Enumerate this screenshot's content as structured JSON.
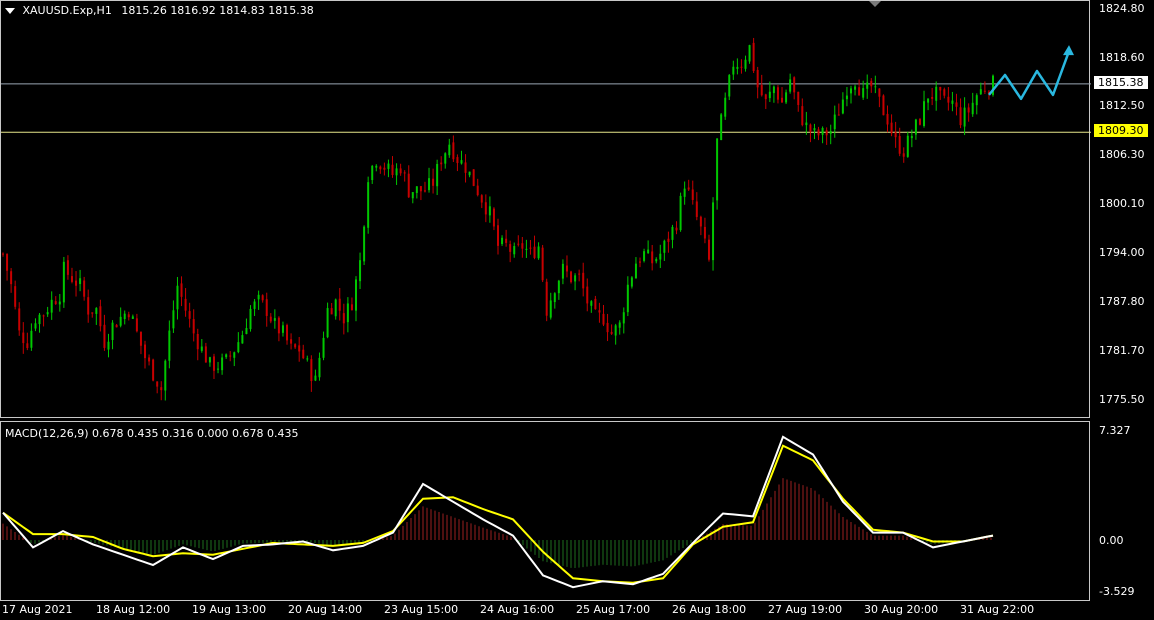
{
  "header": {
    "symbol": "XAUUSD.Exp,H1",
    "ohlc": "1815.26 1816.92 1814.83 1815.38"
  },
  "price_axis": {
    "ticks": [
      "1824.80",
      "1818.60",
      "1812.50",
      "1806.30",
      "1800.10",
      "1794.00",
      "1787.80",
      "1781.70",
      "1775.50"
    ]
  },
  "hlines": {
    "current": "1815.38",
    "level": "1809.30"
  },
  "macd": {
    "label": "MACD(12,26,9) 0.678 0.435 0.316 0.000 0.678 0.435",
    "ticks": [
      "7.327",
      "0.00",
      "-3.529"
    ]
  },
  "time_axis": {
    "ticks": [
      "17 Aug 2021",
      "18 Aug 12:00",
      "19 Aug 13:00",
      "20 Aug 14:00",
      "23 Aug 15:00",
      "24 Aug 16:00",
      "25 Aug 17:00",
      "26 Aug 18:00",
      "27 Aug 19:00",
      "30 Aug 20:00",
      "31 Aug 22:00"
    ]
  },
  "colors": {
    "bull": "#00c800",
    "bear": "#c80000",
    "macd_line": "#ffffff",
    "signal_line": "#ffff00",
    "hist_up": "#9a2020",
    "hist_down": "#1e6e1e",
    "forecast_arrow": "#2ab8e0"
  },
  "chart_data": {
    "type": "candlestick",
    "symbol": "XAUUSD",
    "timeframe": "H1",
    "y_range": [
      1773.0,
      1826.5
    ],
    "close_path": [
      [
        0,
        1794.0
      ],
      [
        4,
        1790.0
      ],
      [
        8,
        1784.0
      ],
      [
        12,
        1783.0
      ],
      [
        16,
        1786.0
      ],
      [
        20,
        1786.5
      ],
      [
        24,
        1788.0
      ],
      [
        28,
        1789.0
      ],
      [
        30,
        1792.0
      ],
      [
        34,
        1791.0
      ],
      [
        38,
        1790.0
      ],
      [
        42,
        1787.0
      ],
      [
        46,
        1787.0
      ],
      [
        50,
        1783.0
      ],
      [
        54,
        1785.0
      ],
      [
        58,
        1786.0
      ],
      [
        62,
        1787.0
      ],
      [
        66,
        1784.0
      ],
      [
        70,
        1781.0
      ],
      [
        74,
        1779.0
      ],
      [
        78,
        1777.0
      ],
      [
        82,
        1784.0
      ],
      [
        86,
        1790.0
      ],
      [
        90,
        1787.0
      ],
      [
        94,
        1784.0
      ],
      [
        98,
        1782.0
      ],
      [
        102,
        1780.0
      ],
      [
        106,
        1780.0
      ],
      [
        110,
        1780.5
      ],
      [
        114,
        1782.0
      ],
      [
        118,
        1784.0
      ],
      [
        122,
        1787.0
      ],
      [
        126,
        1788.0
      ],
      [
        130,
        1787.0
      ],
      [
        134,
        1785.0
      ],
      [
        138,
        1784.0
      ],
      [
        142,
        1782.0
      ],
      [
        146,
        1782.0
      ],
      [
        150,
        1780.0
      ],
      [
        154,
        1778.0
      ],
      [
        160,
        1787.0
      ],
      [
        164,
        1788.0
      ],
      [
        168,
        1786.0
      ],
      [
        172,
        1788.0
      ],
      [
        176,
        1793.0
      ],
      [
        180,
        1804.0
      ],
      [
        184,
        1806.0
      ],
      [
        188,
        1805.0
      ],
      [
        192,
        1804.0
      ],
      [
        196,
        1805.0
      ],
      [
        200,
        1802.0
      ],
      [
        204,
        1802.0
      ],
      [
        208,
        1802.0
      ],
      [
        212,
        1803.0
      ],
      [
        216,
        1806.0
      ],
      [
        220,
        1808.0
      ],
      [
        224,
        1806.0
      ],
      [
        228,
        1805.0
      ],
      [
        232,
        1803.0
      ],
      [
        236,
        1801.0
      ],
      [
        240,
        1799.0
      ],
      [
        244,
        1795.0
      ],
      [
        248,
        1795.0
      ],
      [
        252,
        1794.0
      ],
      [
        256,
        1795.0
      ],
      [
        260,
        1794.0
      ],
      [
        264,
        1795.0
      ],
      [
        268,
        1787.0
      ],
      [
        272,
        1790.0
      ],
      [
        276,
        1792.0
      ],
      [
        280,
        1791.0
      ],
      [
        284,
        1791.0
      ],
      [
        288,
        1788.0
      ],
      [
        292,
        1786.0
      ],
      [
        296,
        1786.0
      ],
      [
        300,
        1784.0
      ],
      [
        304,
        1785.0
      ],
      [
        308,
        1790.0
      ],
      [
        312,
        1793.0
      ],
      [
        316,
        1794.0
      ],
      [
        320,
        1793.0
      ],
      [
        324,
        1794.0
      ],
      [
        328,
        1796.0
      ],
      [
        332,
        1798.0
      ],
      [
        336,
        1803.0
      ],
      [
        340,
        1800.0
      ],
      [
        344,
        1797.0
      ],
      [
        348,
        1793.0
      ],
      [
        352,
        1808.0
      ],
      [
        356,
        1813.0
      ],
      [
        360,
        1818.0
      ],
      [
        364,
        1818.0
      ],
      [
        368,
        1820.0
      ],
      [
        372,
        1815.0
      ],
      [
        376,
        1813.0
      ],
      [
        380,
        1815.0
      ],
      [
        384,
        1813.0
      ],
      [
        388,
        1816.0
      ],
      [
        392,
        1812.0
      ],
      [
        396,
        1810.0
      ],
      [
        400,
        1809.0
      ],
      [
        404,
        1809.0
      ],
      [
        408,
        1809.5
      ],
      [
        412,
        1812.0
      ],
      [
        416,
        1815.0
      ],
      [
        420,
        1816.0
      ],
      [
        424,
        1814.0
      ],
      [
        428,
        1815.0
      ],
      [
        432,
        1813.0
      ],
      [
        436,
        1811.0
      ],
      [
        440,
        1808.0
      ],
      [
        444,
        1807.0
      ],
      [
        448,
        1809.0
      ],
      [
        452,
        1811.0
      ],
      [
        456,
        1814.0
      ],
      [
        460,
        1814.0
      ],
      [
        464,
        1813.0
      ],
      [
        468,
        1813.0
      ],
      [
        472,
        1811.0
      ],
      [
        476,
        1812.0
      ],
      [
        480,
        1814.0
      ],
      [
        484,
        1815.0
      ],
      [
        488,
        1815.38
      ]
    ],
    "macd_path": [
      [
        0,
        1.85
      ],
      [
        6,
        -0.5
      ],
      [
        12,
        0.6
      ],
      [
        18,
        -0.3
      ],
      [
        24,
        -1.0
      ],
      [
        30,
        -1.7
      ],
      [
        36,
        -0.5
      ],
      [
        42,
        -1.3
      ],
      [
        48,
        -0.4
      ],
      [
        54,
        -0.3
      ],
      [
        60,
        -0.1
      ],
      [
        66,
        -0.7
      ],
      [
        72,
        -0.4
      ],
      [
        78,
        0.5
      ],
      [
        84,
        3.8
      ],
      [
        90,
        2.6
      ],
      [
        96,
        1.4
      ],
      [
        102,
        0.3
      ],
      [
        108,
        -2.4
      ],
      [
        114,
        -3.2
      ],
      [
        120,
        -2.8
      ],
      [
        126,
        -3.0
      ],
      [
        132,
        -2.3
      ],
      [
        138,
        -0.2
      ],
      [
        144,
        1.8
      ],
      [
        150,
        1.6
      ],
      [
        156,
        7.0
      ],
      [
        162,
        5.8
      ],
      [
        168,
        2.6
      ],
      [
        174,
        0.5
      ],
      [
        180,
        0.5
      ],
      [
        186,
        -0.5
      ],
      [
        192,
        -0.1
      ],
      [
        198,
        0.3
      ]
    ],
    "signal_path": [
      [
        0,
        1.85
      ],
      [
        6,
        0.4
      ],
      [
        12,
        0.4
      ],
      [
        18,
        0.2
      ],
      [
        24,
        -0.6
      ],
      [
        30,
        -1.1
      ],
      [
        36,
        -0.9
      ],
      [
        42,
        -1.0
      ],
      [
        48,
        -0.6
      ],
      [
        54,
        -0.2
      ],
      [
        60,
        -0.3
      ],
      [
        66,
        -0.4
      ],
      [
        72,
        -0.2
      ],
      [
        78,
        0.6
      ],
      [
        84,
        2.8
      ],
      [
        90,
        2.9
      ],
      [
        96,
        2.1
      ],
      [
        102,
        1.4
      ],
      [
        108,
        -0.8
      ],
      [
        114,
        -2.6
      ],
      [
        120,
        -2.8
      ],
      [
        126,
        -2.9
      ],
      [
        132,
        -2.6
      ],
      [
        138,
        -0.3
      ],
      [
        144,
        0.9
      ],
      [
        150,
        1.2
      ],
      [
        156,
        6.4
      ],
      [
        162,
        5.4
      ],
      [
        168,
        2.8
      ],
      [
        174,
        0.7
      ],
      [
        180,
        0.5
      ],
      [
        186,
        -0.1
      ],
      [
        192,
        -0.1
      ],
      [
        198,
        0.3
      ]
    ],
    "forecast_path": [
      [
        0,
        1814.0
      ],
      [
        1,
        1816.5
      ],
      [
        2,
        1813.5
      ],
      [
        3,
        1817.0
      ],
      [
        4,
        1814.0
      ],
      [
        5,
        1819.5
      ]
    ],
    "macd_y_range": [
      -3.529,
      7.327
    ]
  }
}
